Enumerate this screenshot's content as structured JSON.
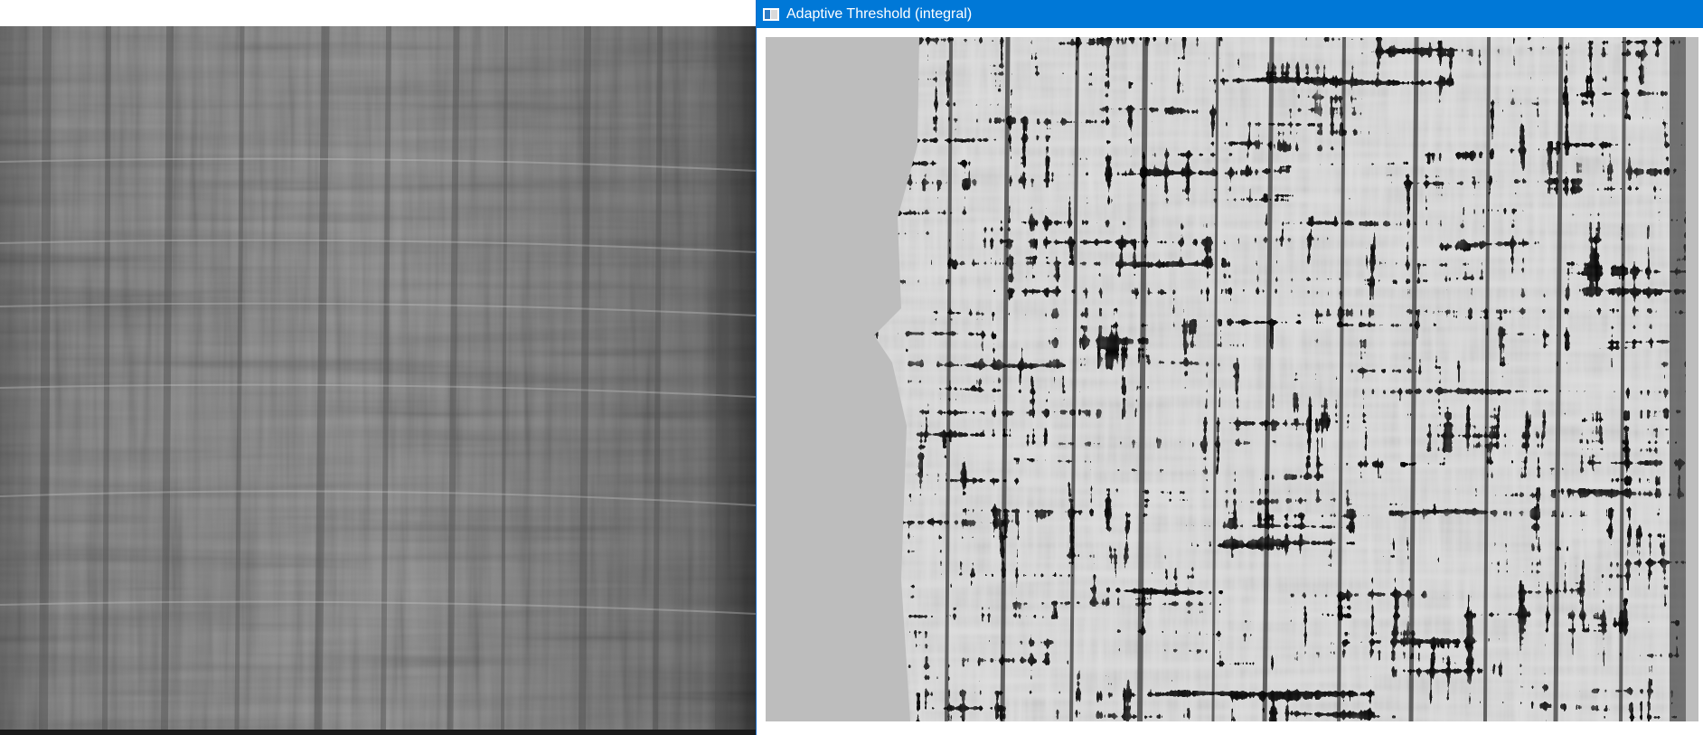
{
  "right_window": {
    "title": "Adaptive Threshold (integral)",
    "icon": "opencv-window-icon"
  },
  "left_window": {
    "image": "grayscale-fibrous-texture-photo"
  },
  "colors": {
    "titlebar": "#0078d7",
    "title_text": "#ffffff",
    "threshold_background": "#bdbdbd",
    "threshold_foreground": "#000000",
    "source_image_tone": "#8a8a8a"
  }
}
